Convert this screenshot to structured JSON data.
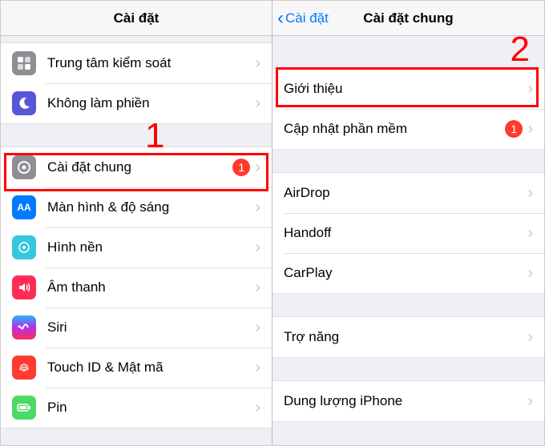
{
  "left": {
    "title": "Cài đặt",
    "groups": [
      {
        "rows": [
          {
            "key": "control-center",
            "label": "Trung tâm kiểm soát"
          },
          {
            "key": "dnd",
            "label": "Không làm phiền"
          }
        ]
      },
      {
        "rows": [
          {
            "key": "general",
            "label": "Cài đặt chung",
            "badge": "1"
          },
          {
            "key": "display",
            "label": "Màn hình & độ sáng"
          },
          {
            "key": "wallpaper",
            "label": "Hình nền"
          },
          {
            "key": "sounds",
            "label": "Âm thanh"
          },
          {
            "key": "siri",
            "label": "Siri"
          },
          {
            "key": "touchid",
            "label": "Touch ID & Mật mã"
          },
          {
            "key": "battery",
            "label": "Pin"
          }
        ]
      }
    ]
  },
  "right": {
    "back": "Cài đặt",
    "title": "Cài đặt chung",
    "groups": [
      {
        "rows": [
          {
            "key": "about",
            "label": "Giới thiệu"
          },
          {
            "key": "software-update",
            "label": "Cập nhật phần mềm",
            "badge": "1"
          }
        ]
      },
      {
        "rows": [
          {
            "key": "airdrop",
            "label": "AirDrop"
          },
          {
            "key": "handoff",
            "label": "Handoff"
          },
          {
            "key": "carplay",
            "label": "CarPlay"
          }
        ]
      },
      {
        "rows": [
          {
            "key": "accessibility",
            "label": "Trợ năng"
          }
        ]
      },
      {
        "rows": [
          {
            "key": "iphone-storage",
            "label": "Dung lượng iPhone"
          }
        ]
      }
    ]
  },
  "annotations": {
    "step1": "1",
    "step2": "2"
  }
}
